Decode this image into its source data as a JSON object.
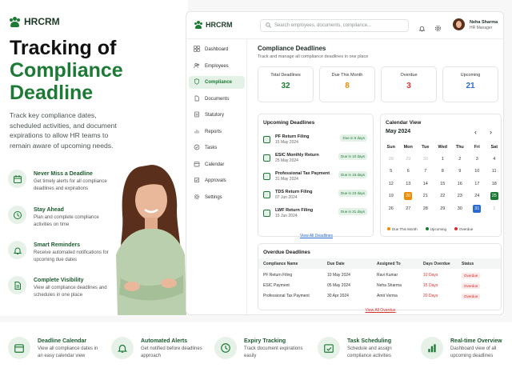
{
  "brand": {
    "name": "HRCRM",
    "accent": "#1c7a35"
  },
  "hero": {
    "title_line1": "Tracking of",
    "title_line2": "Compliance",
    "title_line3": "Deadline",
    "lead": "Track key compliance dates, scheduled activities, and document expirations to allow HR teams to remain aware of upcoming needs.",
    "features": [
      {
        "icon": "calendar-icon",
        "title": "Never Miss a Deadline",
        "desc": "Get timely alerts for all compliance deadlines and expirations"
      },
      {
        "icon": "clock-icon",
        "title": "Stay Ahead",
        "desc": "Plan and complete compliance activities on time"
      },
      {
        "icon": "bell-icon",
        "title": "Smart Reminders",
        "desc": "Receive automated notifications for upcoming due dates"
      },
      {
        "icon": "document-icon",
        "title": "Complete Visibility",
        "desc": "View all compliance deadlines and schedules in one place"
      }
    ]
  },
  "app": {
    "logo": "HRCRM",
    "search_placeholder": "Search employees, documents, compliance...",
    "user": {
      "name": "Neha Sharma",
      "role": "HR Manager"
    },
    "nav": [
      {
        "label": "Dashboard",
        "icon": "grid-icon"
      },
      {
        "label": "Employees",
        "icon": "users-icon"
      },
      {
        "label": "Compliance",
        "icon": "shield-icon",
        "active": true
      },
      {
        "label": "Documents",
        "icon": "document-icon"
      },
      {
        "label": "Statutory",
        "icon": "file-icon"
      },
      {
        "label": "Reports",
        "icon": "chart-icon"
      },
      {
        "label": "Tasks",
        "icon": "check-circle-icon"
      },
      {
        "label": "Calendar",
        "icon": "calendar-icon"
      },
      {
        "label": "Approvals",
        "icon": "approve-icon"
      },
      {
        "label": "Settings",
        "icon": "gear-icon"
      }
    ],
    "page_title": "Compliance Deadlines",
    "page_subtitle": "Track and manage all compliance deadlines in one place",
    "stats": [
      {
        "label": "Total Deadlines",
        "value": "32",
        "color": "#1c7a35"
      },
      {
        "label": "Due This Month",
        "value": "8",
        "color": "#f08c00"
      },
      {
        "label": "Overdue",
        "value": "3",
        "color": "#d93030"
      },
      {
        "label": "Upcoming",
        "value": "21",
        "color": "#2a6bd1"
      }
    ],
    "upcoming": {
      "title": "Upcoming Deadlines",
      "items": [
        {
          "name": "PF Return Filing",
          "date": "15 May 2024",
          "badge": "Due in 5 days"
        },
        {
          "name": "ESIC Monthly Return",
          "date": "25 May 2024",
          "badge": "Due in 10 days"
        },
        {
          "name": "Professional Tax Payment",
          "date": "31 May 2024",
          "badge": "Due in 16 days"
        },
        {
          "name": "TDS Return Filing",
          "date": "07 Jun 2024",
          "badge": "Due in 23 days"
        },
        {
          "name": "LWF Return Filing",
          "date": "15 Jun 2024",
          "badge": "Due in 31 days"
        }
      ],
      "view_all": "View All Deadlines"
    },
    "calendar": {
      "title": "Calendar View",
      "month": "May 2024",
      "days": [
        "Sun",
        "Mon",
        "Tue",
        "Wed",
        "Thu",
        "Fri",
        "Sat"
      ],
      "weeks": [
        [
          "28",
          "29",
          "30",
          "1",
          "2",
          "3",
          "4"
        ],
        [
          "5",
          "6",
          "7",
          "8",
          "9",
          "10",
          "11"
        ],
        [
          "12",
          "13",
          "14",
          "15",
          "16",
          "17",
          "18"
        ],
        [
          "19",
          "20",
          "21",
          "22",
          "23",
          "24",
          "25"
        ],
        [
          "26",
          "27",
          "28",
          "29",
          "30",
          "31",
          "1"
        ]
      ],
      "legend": [
        "Due This Month",
        "Upcoming",
        "Overdue"
      ],
      "prev": "‹",
      "next": "›"
    },
    "overdue": {
      "title": "Overdue Deadlines",
      "headers": [
        "Compliance Name",
        "Due Date",
        "Assigned To",
        "Days Overdue",
        "Status"
      ],
      "rows": [
        [
          "PF Return Filing",
          "10 May 2024",
          "Ravi Kumar",
          "10 Days",
          "Overdue"
        ],
        [
          "ESIC Payment",
          "05 May 2024",
          "Neha Sharma",
          "15 Days",
          "Overdue"
        ],
        [
          "Professional Tax Payment",
          "30 Apr 2024",
          "Amit Verma",
          "20 Days",
          "Overdue"
        ]
      ],
      "view_all": "View All Overdue"
    }
  },
  "bottom": [
    {
      "icon": "calendar-icon",
      "title": "Deadline Calendar",
      "desc": "View all compliance dates in an easy calendar view"
    },
    {
      "icon": "bell-icon",
      "title": "Automated Alerts",
      "desc": "Get notified before deadlines approach"
    },
    {
      "icon": "clock-icon",
      "title": "Expiry Tracking",
      "desc": "Track document expirations easily"
    },
    {
      "icon": "task-icon",
      "title": "Task Scheduling",
      "desc": "Schedule and assign compliance activities"
    },
    {
      "icon": "bar-chart-icon",
      "title": "Real-time Overview",
      "desc": "Dashboard view of all upcoming deadlines"
    }
  ]
}
